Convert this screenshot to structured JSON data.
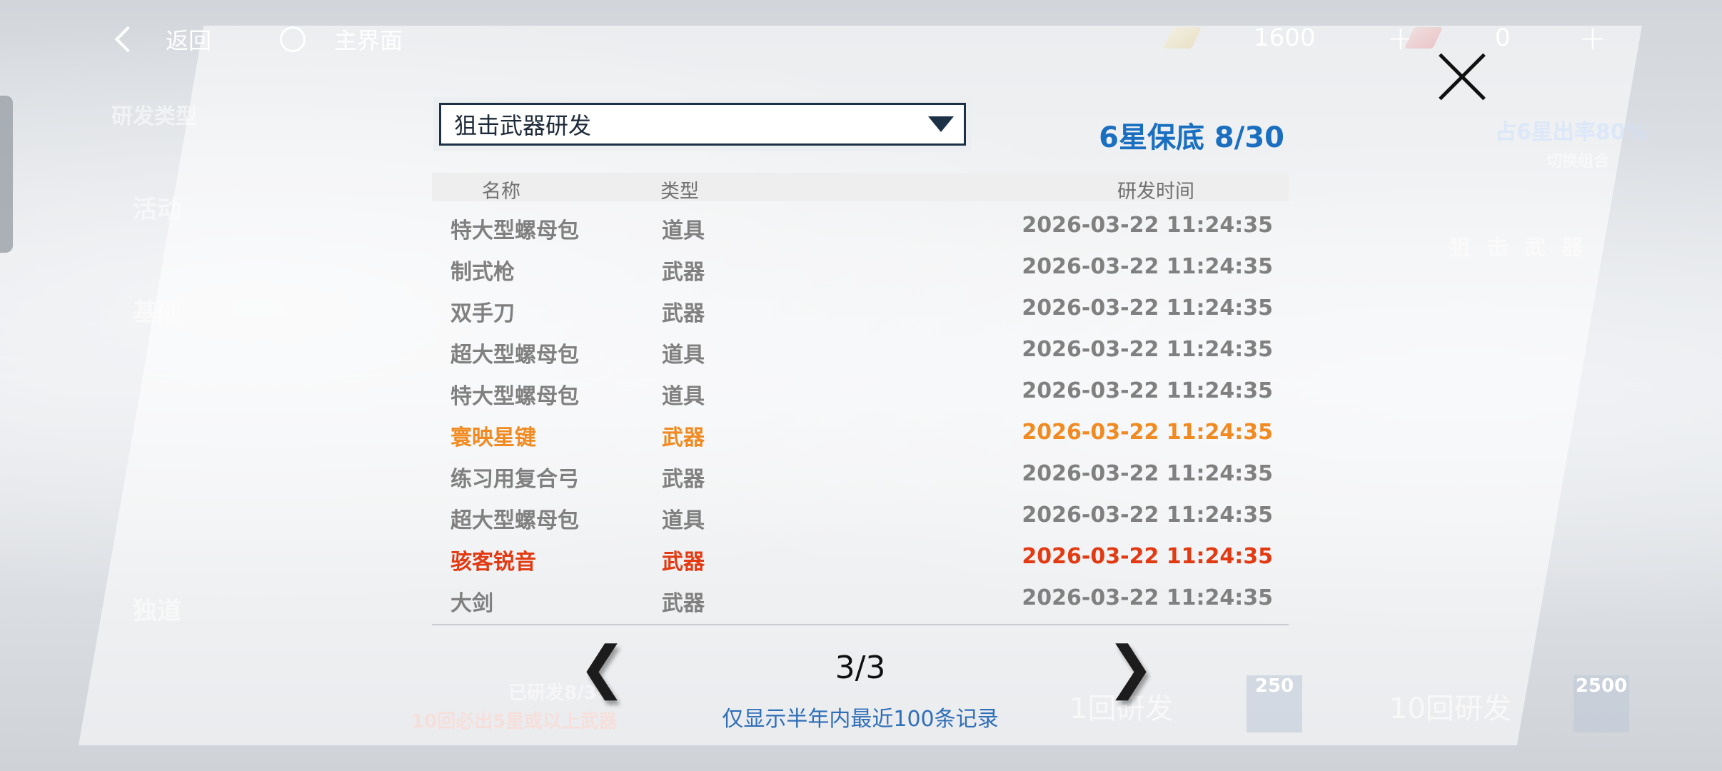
{
  "topbar": {
    "back_label": "返回",
    "home_label": "主界面",
    "currency1_value": "1600",
    "currency2_value": "0",
    "plus_symbol": "+"
  },
  "background": {
    "research_type": "研发类型",
    "tab_activity": "活动",
    "tab_basic": "基础",
    "tab_exclusive": "独道",
    "sniper_weapon": "狙 击 武 器",
    "rate_text": "占6星出率80%",
    "switch_combo": "切换组合",
    "guarantee_text": "已研发8/30",
    "ten_times_text": "10回必出5星或以上武器",
    "btn_1x": "1回研发",
    "btn_10x": "10回研发",
    "cost_1x": "250",
    "cost_10x": "2500"
  },
  "dialog": {
    "dropdown_label": "狙击武器研发",
    "pity_text": "6星保底 8/30",
    "columns": {
      "name": "名称",
      "type": "类型",
      "time": "研发时间"
    },
    "rows": [
      {
        "name": "特大型螺母包",
        "type": "道具",
        "time": "2026-03-22 11:24:35",
        "rarity": "normal"
      },
      {
        "name": "制式枪",
        "type": "武器",
        "time": "2026-03-22 11:24:35",
        "rarity": "normal"
      },
      {
        "name": "双手刀",
        "type": "武器",
        "time": "2026-03-22 11:24:35",
        "rarity": "normal"
      },
      {
        "name": "超大型螺母包",
        "type": "道具",
        "time": "2026-03-22 11:24:35",
        "rarity": "normal"
      },
      {
        "name": "特大型螺母包",
        "type": "道具",
        "time": "2026-03-22 11:24:35",
        "rarity": "normal"
      },
      {
        "name": "寰映星键",
        "type": "武器",
        "time": "2026-03-22 11:24:35",
        "rarity": "orange"
      },
      {
        "name": "练习用复合弓",
        "type": "武器",
        "time": "2026-03-22 11:24:35",
        "rarity": "normal"
      },
      {
        "name": "超大型螺母包",
        "type": "道具",
        "time": "2026-03-22 11:24:35",
        "rarity": "normal"
      },
      {
        "name": "骇客锐音",
        "type": "武器",
        "time": "2026-03-22 11:24:35",
        "rarity": "red"
      },
      {
        "name": "大剑",
        "type": "武器",
        "time": "2026-03-22 11:24:35",
        "rarity": "normal"
      }
    ],
    "page_indicator": "3/3",
    "prev_glyph": "❮",
    "next_glyph": "❯",
    "note": "仅显示半年内最近100条记录"
  },
  "colors": {
    "normal_text": "#808080",
    "orange_rarity": "#f08a21",
    "red_rarity": "#e23a12",
    "pity_blue": "#1a6fc0",
    "note_blue": "#2f6fb8"
  }
}
